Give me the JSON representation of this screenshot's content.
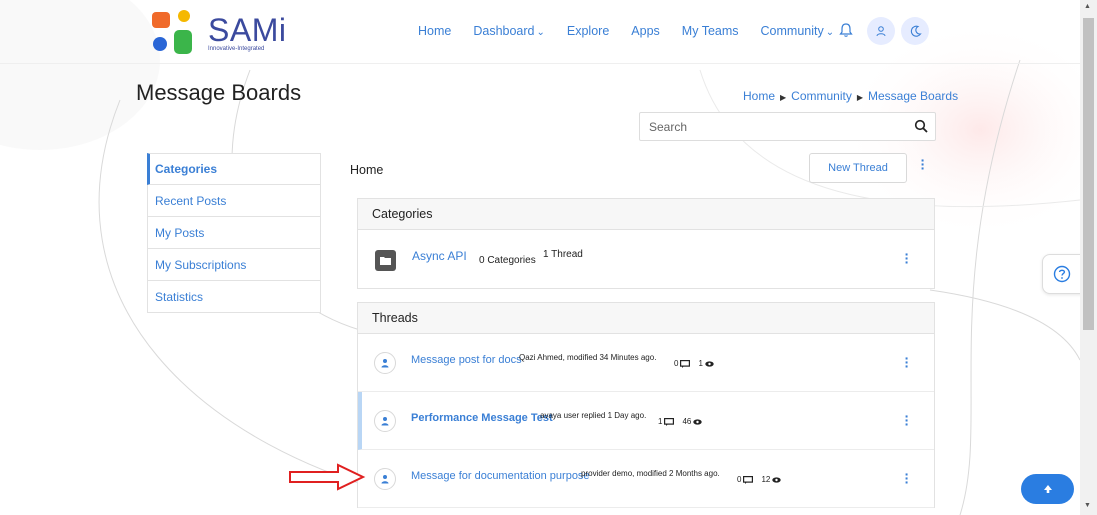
{
  "header": {
    "brand": "SAMi",
    "tagline": "Innovative-Integrated",
    "nav": [
      {
        "label": "Home"
      },
      {
        "label": "Dashboard",
        "dropdown": true
      },
      {
        "label": "Explore"
      },
      {
        "label": "Apps"
      },
      {
        "label": "My Teams"
      },
      {
        "label": "Community",
        "dropdown": true
      }
    ],
    "icons": [
      "bell-icon",
      "user-icon",
      "moon-icon"
    ]
  },
  "page": {
    "title": "Message Boards",
    "breadcrumb": [
      "Home",
      "Community",
      "Message Boards"
    ],
    "search_placeholder": "Search"
  },
  "sidebar": {
    "items": [
      {
        "label": "Categories",
        "active": true
      },
      {
        "label": "Recent Posts"
      },
      {
        "label": "My Posts"
      },
      {
        "label": "My Subscriptions"
      },
      {
        "label": "Statistics"
      }
    ]
  },
  "main": {
    "crumb": "Home",
    "new_thread_label": "New Thread",
    "categories_header": "Categories",
    "category": {
      "name": "Async API",
      "sub_count": "0 Categories",
      "thread_count": "1 Thread"
    },
    "threads_header": "Threads",
    "threads": [
      {
        "title": "Message post for docs",
        "meta": "Qazi Ahmed, modified 34 Minutes ago.",
        "replies": "0",
        "views": "1",
        "bold": false
      },
      {
        "title": "Performance Message Test",
        "meta": "avaya user replied 1 Day ago.",
        "replies": "1",
        "views": "46",
        "bold": true
      },
      {
        "title": "Message for documentation purpose",
        "meta": "provider demo, modified 2 Months ago.",
        "replies": "0",
        "views": "12",
        "bold": false
      }
    ]
  },
  "colors": {
    "accent": "#3a7fd5",
    "scroll_top_button": "#2a7de1",
    "arrow": "#e02020"
  }
}
